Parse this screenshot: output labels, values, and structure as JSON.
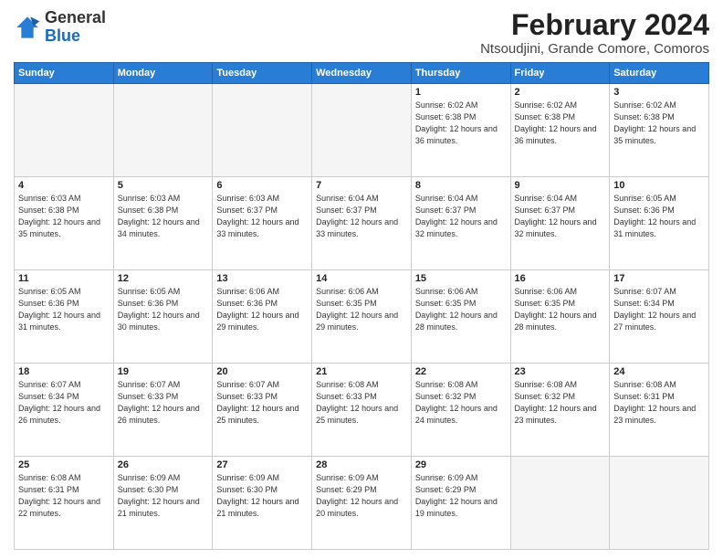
{
  "header": {
    "logo_line1": "General",
    "logo_line2": "Blue",
    "month_title": "February 2024",
    "location": "Ntsoudjini, Grande Comore, Comoros"
  },
  "weekdays": [
    "Sunday",
    "Monday",
    "Tuesday",
    "Wednesday",
    "Thursday",
    "Friday",
    "Saturday"
  ],
  "weeks": [
    [
      {
        "day": "",
        "empty": true
      },
      {
        "day": "",
        "empty": true
      },
      {
        "day": "",
        "empty": true
      },
      {
        "day": "",
        "empty": true
      },
      {
        "day": "1",
        "info": "Sunrise: 6:02 AM\nSunset: 6:38 PM\nDaylight: 12 hours\nand 36 minutes."
      },
      {
        "day": "2",
        "info": "Sunrise: 6:02 AM\nSunset: 6:38 PM\nDaylight: 12 hours\nand 36 minutes."
      },
      {
        "day": "3",
        "info": "Sunrise: 6:02 AM\nSunset: 6:38 PM\nDaylight: 12 hours\nand 35 minutes."
      }
    ],
    [
      {
        "day": "4",
        "info": "Sunrise: 6:03 AM\nSunset: 6:38 PM\nDaylight: 12 hours\nand 35 minutes."
      },
      {
        "day": "5",
        "info": "Sunrise: 6:03 AM\nSunset: 6:38 PM\nDaylight: 12 hours\nand 34 minutes."
      },
      {
        "day": "6",
        "info": "Sunrise: 6:03 AM\nSunset: 6:37 PM\nDaylight: 12 hours\nand 33 minutes."
      },
      {
        "day": "7",
        "info": "Sunrise: 6:04 AM\nSunset: 6:37 PM\nDaylight: 12 hours\nand 33 minutes."
      },
      {
        "day": "8",
        "info": "Sunrise: 6:04 AM\nSunset: 6:37 PM\nDaylight: 12 hours\nand 32 minutes."
      },
      {
        "day": "9",
        "info": "Sunrise: 6:04 AM\nSunset: 6:37 PM\nDaylight: 12 hours\nand 32 minutes."
      },
      {
        "day": "10",
        "info": "Sunrise: 6:05 AM\nSunset: 6:36 PM\nDaylight: 12 hours\nand 31 minutes."
      }
    ],
    [
      {
        "day": "11",
        "info": "Sunrise: 6:05 AM\nSunset: 6:36 PM\nDaylight: 12 hours\nand 31 minutes."
      },
      {
        "day": "12",
        "info": "Sunrise: 6:05 AM\nSunset: 6:36 PM\nDaylight: 12 hours\nand 30 minutes."
      },
      {
        "day": "13",
        "info": "Sunrise: 6:06 AM\nSunset: 6:36 PM\nDaylight: 12 hours\nand 29 minutes."
      },
      {
        "day": "14",
        "info": "Sunrise: 6:06 AM\nSunset: 6:35 PM\nDaylight: 12 hours\nand 29 minutes."
      },
      {
        "day": "15",
        "info": "Sunrise: 6:06 AM\nSunset: 6:35 PM\nDaylight: 12 hours\nand 28 minutes."
      },
      {
        "day": "16",
        "info": "Sunrise: 6:06 AM\nSunset: 6:35 PM\nDaylight: 12 hours\nand 28 minutes."
      },
      {
        "day": "17",
        "info": "Sunrise: 6:07 AM\nSunset: 6:34 PM\nDaylight: 12 hours\nand 27 minutes."
      }
    ],
    [
      {
        "day": "18",
        "info": "Sunrise: 6:07 AM\nSunset: 6:34 PM\nDaylight: 12 hours\nand 26 minutes."
      },
      {
        "day": "19",
        "info": "Sunrise: 6:07 AM\nSunset: 6:33 PM\nDaylight: 12 hours\nand 26 minutes."
      },
      {
        "day": "20",
        "info": "Sunrise: 6:07 AM\nSunset: 6:33 PM\nDaylight: 12 hours\nand 25 minutes."
      },
      {
        "day": "21",
        "info": "Sunrise: 6:08 AM\nSunset: 6:33 PM\nDaylight: 12 hours\nand 25 minutes."
      },
      {
        "day": "22",
        "info": "Sunrise: 6:08 AM\nSunset: 6:32 PM\nDaylight: 12 hours\nand 24 minutes."
      },
      {
        "day": "23",
        "info": "Sunrise: 6:08 AM\nSunset: 6:32 PM\nDaylight: 12 hours\nand 23 minutes."
      },
      {
        "day": "24",
        "info": "Sunrise: 6:08 AM\nSunset: 6:31 PM\nDaylight: 12 hours\nand 23 minutes."
      }
    ],
    [
      {
        "day": "25",
        "info": "Sunrise: 6:08 AM\nSunset: 6:31 PM\nDaylight: 12 hours\nand 22 minutes."
      },
      {
        "day": "26",
        "info": "Sunrise: 6:09 AM\nSunset: 6:30 PM\nDaylight: 12 hours\nand 21 minutes."
      },
      {
        "day": "27",
        "info": "Sunrise: 6:09 AM\nSunset: 6:30 PM\nDaylight: 12 hours\nand 21 minutes."
      },
      {
        "day": "28",
        "info": "Sunrise: 6:09 AM\nSunset: 6:29 PM\nDaylight: 12 hours\nand 20 minutes."
      },
      {
        "day": "29",
        "info": "Sunrise: 6:09 AM\nSunset: 6:29 PM\nDaylight: 12 hours\nand 19 minutes."
      },
      {
        "day": "",
        "empty": true
      },
      {
        "day": "",
        "empty": true
      }
    ]
  ]
}
